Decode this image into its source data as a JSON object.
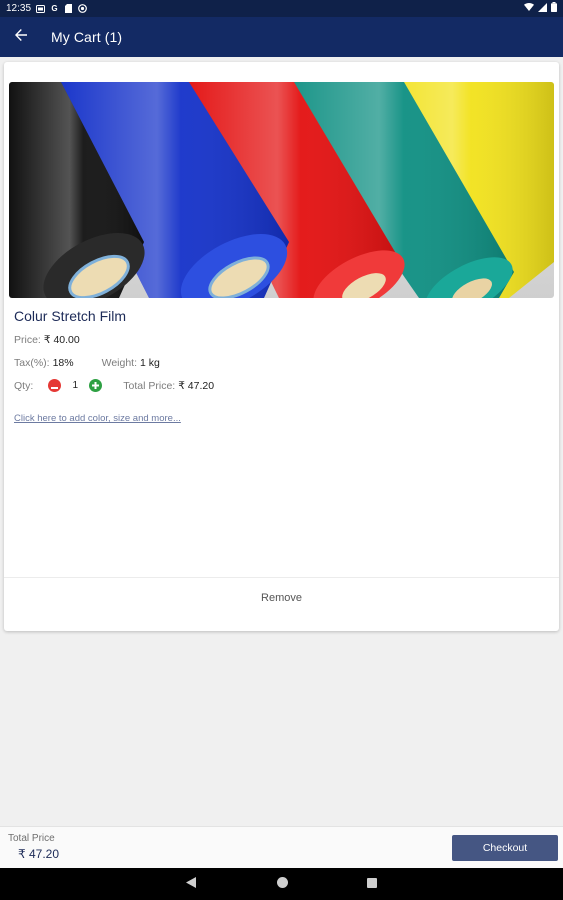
{
  "status_bar": {
    "time": "12:35",
    "icons": [
      "sim-icon",
      "google-icon",
      "sd-card-icon",
      "record-icon",
      "wifi-icon",
      "signal-icon",
      "battery-icon"
    ]
  },
  "app_bar": {
    "title": "My Cart (1)",
    "background": "#132a64",
    "back_icon": "arrow-left-icon"
  },
  "cart_item": {
    "name": "Colur Stretch Film",
    "price_label": "Price:",
    "price_value": "₹ 40.00",
    "tax_label": "Tax(%):",
    "tax_value": "18%",
    "weight_label": "Weight:",
    "weight_value": "1 kg",
    "qty_label": "Qty:",
    "qty_value": "1",
    "total_label": "Total Price:",
    "total_value": "₹ 47.20",
    "options_link": "Click here to add color, size and more...",
    "remove_label": "Remove",
    "image_rolls": [
      "#111111",
      "#1431c9",
      "#e31010",
      "#0e8f82",
      "#f2e21b"
    ]
  },
  "bottom_bar": {
    "total_label": "Total Price",
    "total_value": "₹ 47.20",
    "checkout_label": "Checkout"
  },
  "colors": {
    "minus": "#e53935",
    "plus": "#2ea043",
    "checkout": "#455683"
  }
}
